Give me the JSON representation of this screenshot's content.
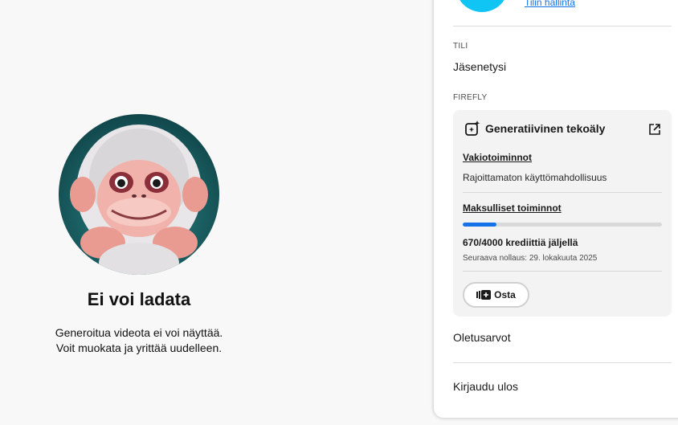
{
  "error": {
    "title": "Ei voi ladata",
    "line1": "Generoitua videota ei voi näyttää.",
    "line2": "Voit muokata ja yrittää uudelleen."
  },
  "panel": {
    "manage_account": "Tilin hallinta",
    "account_section": "TILI",
    "membership": "Jäsenetysi",
    "firefly_section": "FIREFLY",
    "defaults": "Oletusarvot",
    "sign_out": "Kirjaudu ulos",
    "avatar_color": "#10c4f4"
  },
  "card": {
    "title": "Generatiivinen tekoäly",
    "icon": "sparkle-icon",
    "external_icon": "open-external-icon",
    "standard_label": "Vakiotoiminnot",
    "standard_text": "Rajoittamaton käyttömahdollisuus",
    "premium_label": "Maksulliset toiminnot",
    "credits_used_fraction": 0.1675,
    "credits_text": "670/4000 krediittiä jäljellä",
    "reset_text": "Seuraava nollaus: 29. lokakuuta 2025",
    "buy_label": "Osta",
    "buy_icon": "credit-cards-icon",
    "accent": "#1473e6"
  }
}
